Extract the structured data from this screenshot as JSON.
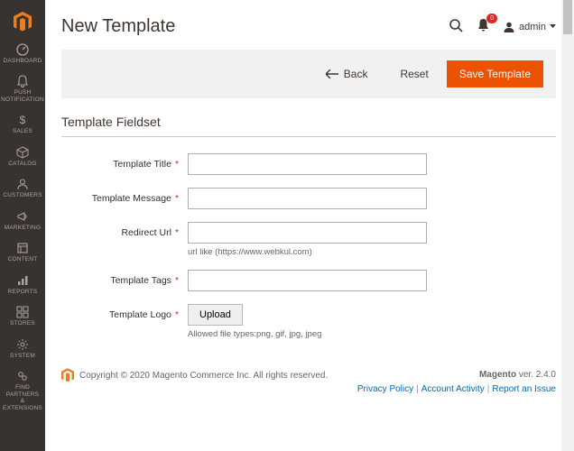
{
  "sidebar": {
    "items": [
      {
        "label": "DASHBOARD",
        "icon": "dashboard"
      },
      {
        "label": "PUSH\nNOTIFICATION",
        "icon": "bell"
      },
      {
        "label": "SALES",
        "icon": "dollar"
      },
      {
        "label": "CATALOG",
        "icon": "cube"
      },
      {
        "label": "CUSTOMERS",
        "icon": "user"
      },
      {
        "label": "MARKETING",
        "icon": "megaphone"
      },
      {
        "label": "CONTENT",
        "icon": "layers"
      },
      {
        "label": "REPORTS",
        "icon": "bars"
      },
      {
        "label": "STORES",
        "icon": "stores"
      },
      {
        "label": "SYSTEM",
        "icon": "gear"
      },
      {
        "label": "FIND PARTNERS\n& EXTENSIONS",
        "icon": "link"
      }
    ]
  },
  "header": {
    "title": "New Template",
    "notifications_count": "0",
    "account_name": "admin"
  },
  "actionbar": {
    "back": "Back",
    "reset": "Reset",
    "save": "Save Template"
  },
  "fieldset": {
    "legend": "Template Fieldset",
    "rows": {
      "title": {
        "label": "Template Title",
        "required": true
      },
      "message": {
        "label": "Template Message",
        "required": true
      },
      "url": {
        "label": "Redirect Url",
        "required": true,
        "hint": "url like (https://www.webkul.com)"
      },
      "tags": {
        "label": "Template Tags",
        "required": true
      },
      "logo": {
        "label": "Template Logo",
        "required": true,
        "button": "Upload",
        "hint": "Allowed file types:png, gif, jpg, jpeg"
      }
    }
  },
  "footer": {
    "copyright": "Copyright © 2020 Magento Commerce Inc. All rights reserved.",
    "version_label": "Magento",
    "version_value": "ver. 2.4.0",
    "links": {
      "privacy": "Privacy Policy",
      "activity": "Account Activity",
      "report": "Report an Issue"
    }
  },
  "colors": {
    "accent": "#eb5202",
    "sidebar_bg": "#373330",
    "danger": "#e22626",
    "link": "#006bb4"
  }
}
